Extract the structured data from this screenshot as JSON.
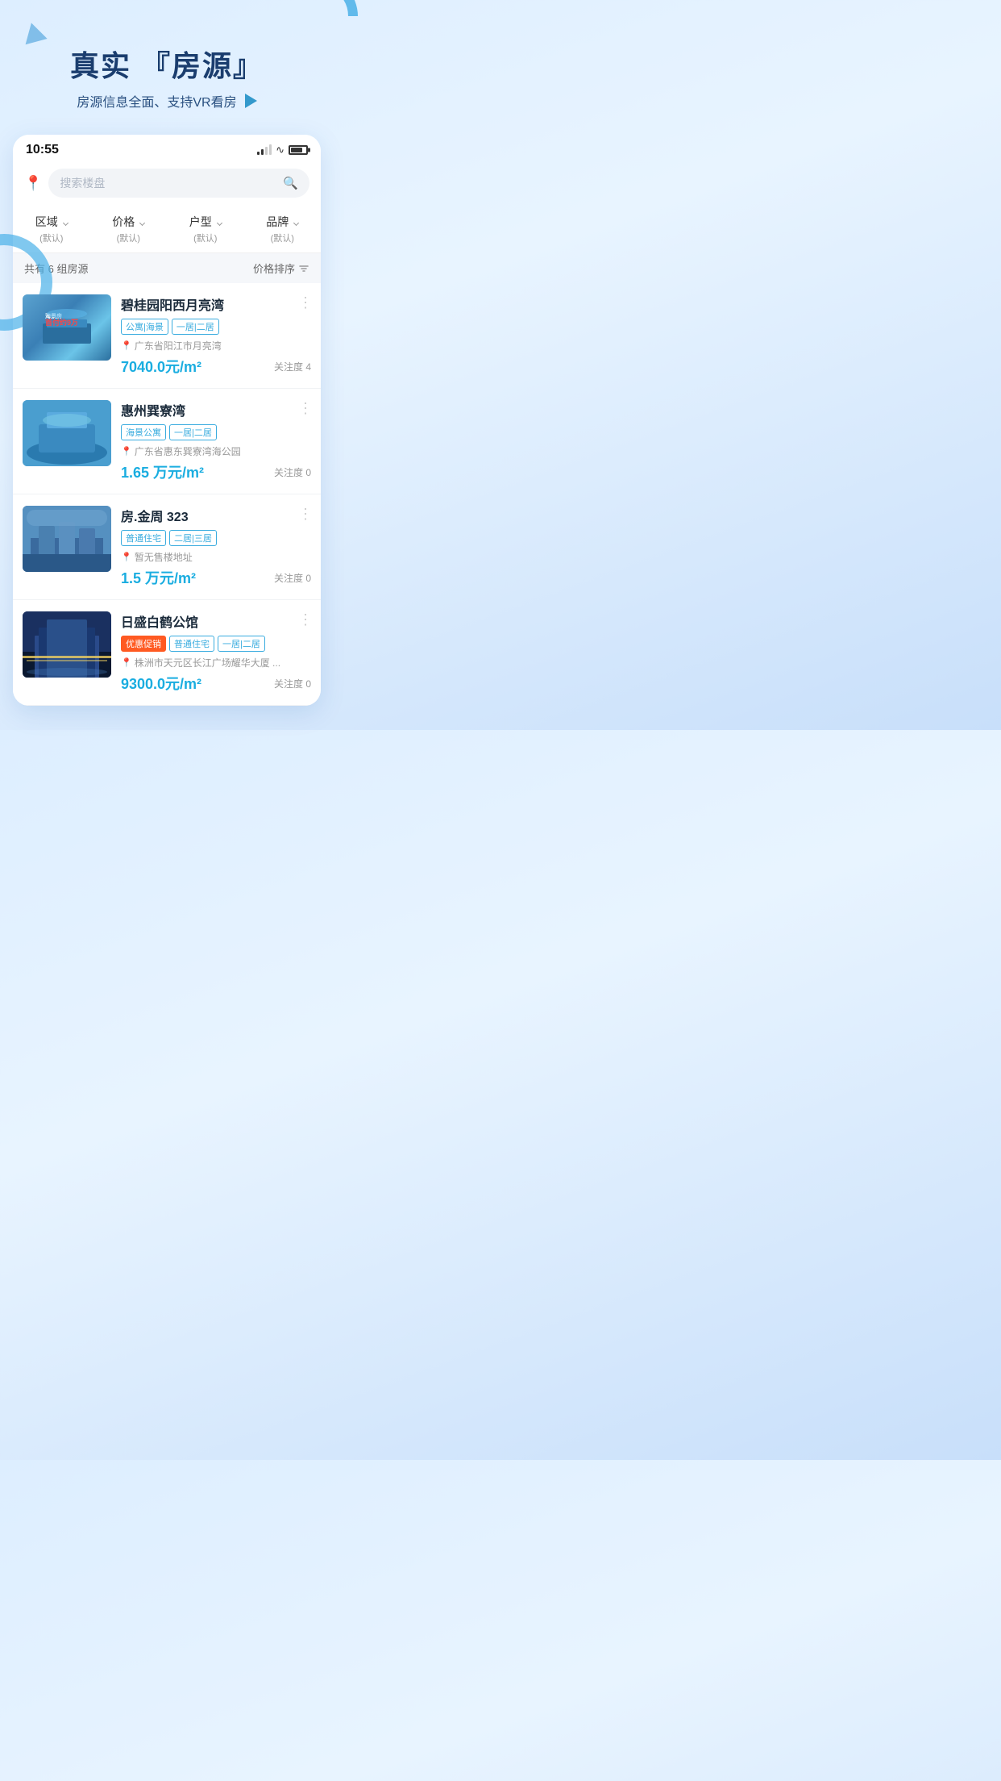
{
  "page": {
    "background": "#d8eaf8"
  },
  "hero": {
    "title": "真实 『房源』",
    "subtitle": "房源信息全面、支持VR看房",
    "play_icon_label": "play"
  },
  "status_bar": {
    "time": "10:55",
    "signal": "signal",
    "wifi": "wifi",
    "battery": "battery"
  },
  "search": {
    "placeholder": "搜索楼盘",
    "location_icon": "location-pin"
  },
  "filters": [
    {
      "label": "区域",
      "sub": "(默认)"
    },
    {
      "label": "价格",
      "sub": "(默认)"
    },
    {
      "label": "户型",
      "sub": "(默认)"
    },
    {
      "label": "品牌",
      "sub": "(默认)"
    }
  ],
  "results": {
    "count_text": "共有 6 组房源",
    "sort_text": "价格排序",
    "sort_icon": "sort-icon"
  },
  "listings": [
    {
      "id": 1,
      "title": "碧桂园阳西月亮湾",
      "tags": [
        "公寓|海景",
        "一居|二居"
      ],
      "promo_tag": null,
      "location": "广东省阳江市月亮湾",
      "price": "7040.0元/m²",
      "attention": "关注度 4"
    },
    {
      "id": 2,
      "title": "惠州巽寮湾",
      "tags": [
        "海景公寓",
        "一居|二居"
      ],
      "promo_tag": null,
      "location": "广东省惠东巽寮湾海公园",
      "price": "1.65 万元/m²",
      "attention": "关注度 0"
    },
    {
      "id": 3,
      "title": "房.金周 323",
      "tags": [
        "普通住宅",
        "二居|三居"
      ],
      "promo_tag": null,
      "location": "暂无售楼地址",
      "price": "1.5 万元/m²",
      "attention": "关注度 0"
    },
    {
      "id": 4,
      "title": "日盛白鹤公馆",
      "tags": [
        "普通住宅",
        "一居|二居"
      ],
      "promo_tag": "优惠促销",
      "location": "株洲市天元区长江广场耀华大厦 ...",
      "price": "9300.0元/m²",
      "attention": "关注度 0"
    }
  ],
  "more_btn_label": "⋮"
}
